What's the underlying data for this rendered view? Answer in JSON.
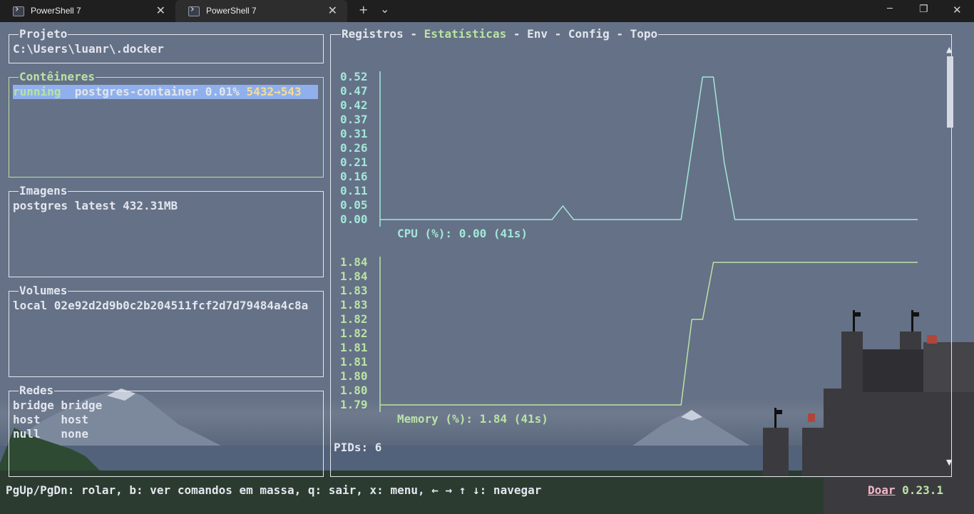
{
  "titlebar": {
    "tabs": [
      {
        "label": "PowerShell 7",
        "icon": "terminal-icon"
      },
      {
        "label": "PowerShell 7",
        "icon": "terminal-icon"
      }
    ],
    "new_tab": "+",
    "dropdown": "⌄",
    "minimize": "─",
    "maximize": "❐",
    "close": "✕",
    "tab_close": "✕"
  },
  "projeto": {
    "title": "Projeto",
    "path": "C:\\Users\\luanr\\.docker"
  },
  "conteineres": {
    "title": "Contêineres",
    "items": [
      {
        "status": "running",
        "name": "postgres-container",
        "cpu": "0.01%",
        "ports": "5432→543"
      }
    ]
  },
  "imagens": {
    "title": "Imagens",
    "items": [
      {
        "line": "postgres latest 432.31MB"
      }
    ]
  },
  "volumes": {
    "title": "Volumes",
    "items": [
      {
        "line": "local 02e92d2d9b0c2b204511fcf2d7d79484a4c8a"
      }
    ]
  },
  "redes": {
    "title": "Redes",
    "items": [
      {
        "line": "bridge bridge"
      },
      {
        "line": "host   host"
      },
      {
        "line": "null   none"
      }
    ]
  },
  "stats": {
    "tabs": {
      "registros": "Registros",
      "estatisticas": "Estatísticas",
      "env": "Env",
      "config": "Config",
      "topo": "Topo",
      "sep": " - "
    },
    "cpu_caption": "CPU (%): 0.00 (41s)",
    "memory_caption": "Memory (%): 1.84 (41s)",
    "pids": "PIDs: 6"
  },
  "chart_data": [
    {
      "type": "line",
      "name": "cpu",
      "y_ticks": [
        "0.52",
        "0.47",
        "0.42",
        "0.37",
        "0.31",
        "0.26",
        "0.21",
        "0.16",
        "0.11",
        "0.05",
        "0.00"
      ],
      "ylim": [
        0.0,
        0.52
      ],
      "xlabel": "CPU (%): 0.00 (41s)",
      "x": [
        0,
        16,
        17,
        18,
        28,
        29,
        30,
        31,
        32,
        33,
        34,
        50
      ],
      "values": [
        0.0,
        0.0,
        0.05,
        0.0,
        0.0,
        0.26,
        0.52,
        0.52,
        0.21,
        0.0,
        0.0,
        0.0
      ],
      "color": "#a2e7d9"
    },
    {
      "type": "line",
      "name": "memory",
      "y_ticks": [
        "1.84",
        "1.84",
        "1.83",
        "1.83",
        "1.82",
        "1.82",
        "1.81",
        "1.81",
        "1.80",
        "1.80",
        "1.79"
      ],
      "ylim": [
        1.79,
        1.84
      ],
      "xlabel": "Memory (%): 1.84 (41s)",
      "x": [
        0,
        28,
        29,
        30,
        31,
        50
      ],
      "values": [
        1.79,
        1.79,
        1.82,
        1.82,
        1.84,
        1.84
      ],
      "color": "#b9e3a4"
    }
  ],
  "footer": {
    "help": "PgUp/PgDn: rolar, b: ver comandos em massa, q: sair, x: menu, ← → ↑ ↓: navegar",
    "donate": "Doar",
    "version": "0.23.1"
  },
  "colors": {
    "accent_green": "#b9e3a4",
    "accent_yellow": "#f5dc95",
    "chart_cyan": "#a2e7d9",
    "selection": "#8fb0ec",
    "background": "#657186"
  }
}
